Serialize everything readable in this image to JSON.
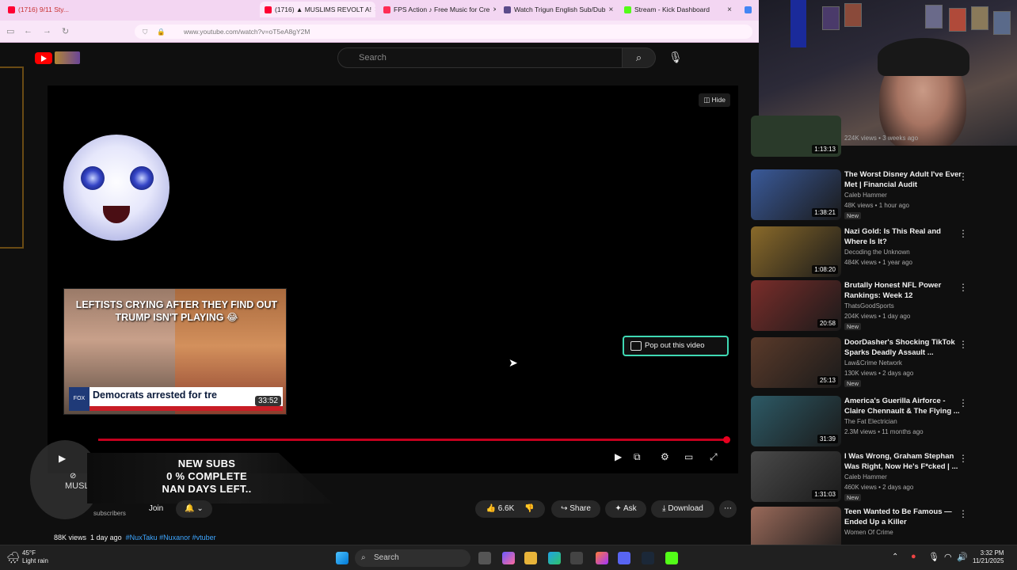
{
  "browser": {
    "tabs": [
      {
        "label": "(1716) 9/11 Sty...",
        "active": false,
        "color": "#ff0033"
      },
      {
        "label": "(1716) ▲ MUSLIMS REVOLT A!",
        "active": true,
        "color": "#ff0033"
      },
      {
        "label": "FPS Action ♪ Free Music for Cre",
        "active": false,
        "color": "#ff2d55"
      },
      {
        "label": "Watch Trigun English Sub/Dub",
        "active": false,
        "color": "#5b4b8a"
      },
      {
        "label": "Stream - Kick Dashboard",
        "active": false,
        "color": "#53fc18"
      }
    ],
    "url": "www.youtube.com/watch?v=oT5eA8gY2M"
  },
  "youtube": {
    "search_placeholder": "Search",
    "player": {
      "hide_label": "Hide",
      "thumb_title": "LEFTISTS CRYING AFTER THEY FIND OUT TRUMP ISN'T PLAYING 😂",
      "thumb_news": "Democrats arrested for tre",
      "thumb_fox": "FOX NEWS",
      "thumb_duration": "33:52",
      "popout_label": "Pop out this video",
      "progress": 0.99
    },
    "overlay": {
      "subs_line1": "NEW SUBS",
      "subs_line2": "0 % COMPLETE",
      "subs_line3": "NAN DAYS LEFT..",
      "channel_name": "MUSLI",
      "subscribers_label": "subscribers"
    },
    "actions": {
      "join": "Join",
      "likes": "6.6K",
      "share": "Share",
      "ask": "Ask",
      "download": "Download"
    },
    "meta": {
      "views": "88K views",
      "age": "1 day ago",
      "tags": "#NuxTaku #Nuxanor #vtuber"
    }
  },
  "sidebar": {
    "top_partial": {
      "views": "224K views • 3 weeks ago",
      "duration": "1:13:13"
    },
    "videos": [
      {
        "title": "The Worst Disney Adult I've Ever Met | Financial Audit",
        "channel": "Caleb Hammer",
        "views": "48K views • 1 hour ago",
        "new": "New",
        "duration": "1:38:21",
        "thumb": "#3a5a9a"
      },
      {
        "title": "Nazi Gold: Is This Real and Where Is It?",
        "channel": "Decoding the Unknown",
        "views": "484K views • 1 year ago",
        "new": "",
        "duration": "1:08:20",
        "thumb": "#8a6a2a"
      },
      {
        "title": "Brutally Honest NFL Power Rankings: Week 12",
        "channel": "ThatsGoodSports",
        "views": "204K views • 1 day ago",
        "new": "New",
        "duration": "20:58",
        "thumb": "#7a2d2a"
      },
      {
        "title": "DoorDasher's Shocking TikTok Sparks Deadly Assault ...",
        "channel": "Law&Crime Network",
        "views": "130K views • 2 days ago",
        "new": "New",
        "duration": "25:13",
        "thumb": "#5a3a2a"
      },
      {
        "title": "America's Guerilla Airforce - Claire Chennault & The Flying ...",
        "channel": "The Fat Electrician",
        "views": "2.3M views • 11 months ago",
        "new": "",
        "duration": "31:39",
        "thumb": "#2d5a66"
      },
      {
        "title": "I Was Wrong, Graham Stephan Was Right, Now He's F*cked | ...",
        "channel": "Caleb Hammer",
        "views": "460K views • 2 days ago",
        "new": "New",
        "duration": "1:31:03",
        "thumb": "#4a4a4a"
      },
      {
        "title": "Teen Wanted to Be Famous — Ended Up a Killer",
        "channel": "Women Of Crime",
        "views": "",
        "new": "",
        "duration": "",
        "thumb": "#9a6a5a"
      }
    ]
  },
  "taskbar": {
    "weather_temp": "45°F",
    "weather_desc": "Light rain",
    "search_label": "Search",
    "time": "3:32 PM",
    "date": "11/21/2025"
  }
}
